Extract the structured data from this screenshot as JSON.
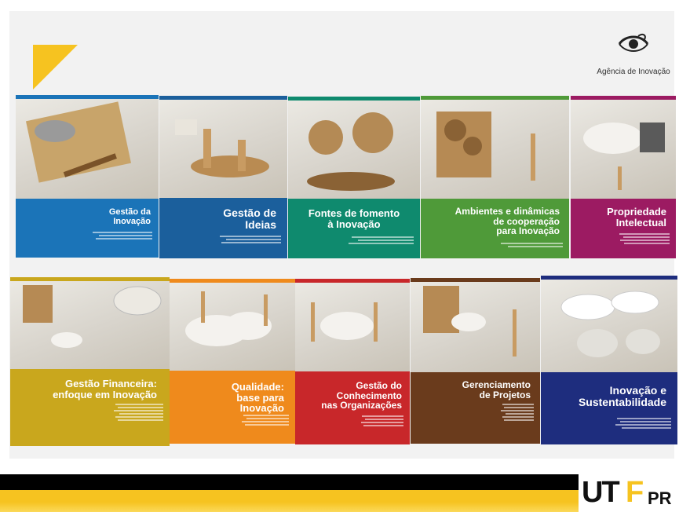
{
  "logo": {
    "text": "Agência de Inovação",
    "icon": "eye-swirl-icon"
  },
  "branding": {
    "utf_big": "UT",
    "utf_f": "F",
    "utf_small": "PR"
  },
  "colors": {
    "accent_yellow": "#f6c320",
    "black": "#000000"
  },
  "books": [
    {
      "title": "Gestão da\nInovação",
      "color": "#1b74b8"
    },
    {
      "title": "Gestão de\nIdeias",
      "color": "#1b5f9c"
    },
    {
      "title": "Fontes de fomento\nà Inovação",
      "color": "#0f8a6e"
    },
    {
      "title": "Ambientes e dinâmicas\nde cooperação\npara Inovação",
      "color": "#4f9a39"
    },
    {
      "title": "Propriedade\nIntelectual",
      "color": "#9c1b62"
    },
    {
      "title": "Gestão Financeira:\nenfoque em Inovação",
      "color": "#c9a71d"
    },
    {
      "title": "Qualidade:\nbase para\nInovação",
      "color": "#ef8a1c"
    },
    {
      "title": "Gestão do\nConhecimento\nnas Organizações",
      "color": "#c8272a"
    },
    {
      "title": "Gerenciamento\nde Projetos",
      "color": "#6a3b1c"
    },
    {
      "title": "Inovação e\nSustentabilidade",
      "color": "#1e2d7e"
    }
  ]
}
